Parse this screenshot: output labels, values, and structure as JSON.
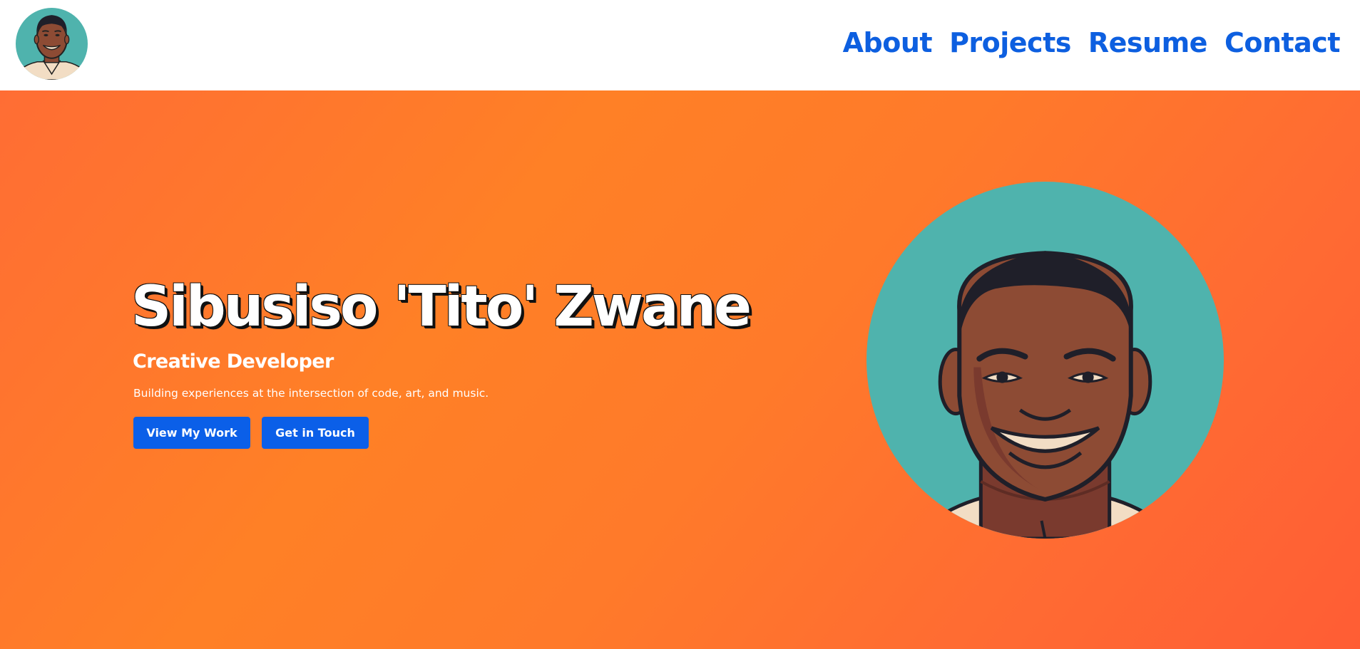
{
  "header": {
    "avatar_icon": "avatar-portrait",
    "nav": [
      {
        "label": "About"
      },
      {
        "label": "Projects"
      },
      {
        "label": "Resume"
      },
      {
        "label": "Contact"
      }
    ],
    "link_color": "#0d5fe0"
  },
  "hero": {
    "name": "Sibusiso 'Tito' Zwane",
    "role": "Creative Developer",
    "tagline": "Building experiences at the intersection of code, art, and music.",
    "buttons": {
      "view_work": "View My Work",
      "get_in_touch": "Get in Touch"
    },
    "portrait_icon": "portrait-illustration",
    "colors": {
      "background_start": "#ff6d34",
      "background_end": "#ff5d34",
      "button": "#0b5fe8",
      "portrait_bg": "#4fb3ad"
    }
  }
}
